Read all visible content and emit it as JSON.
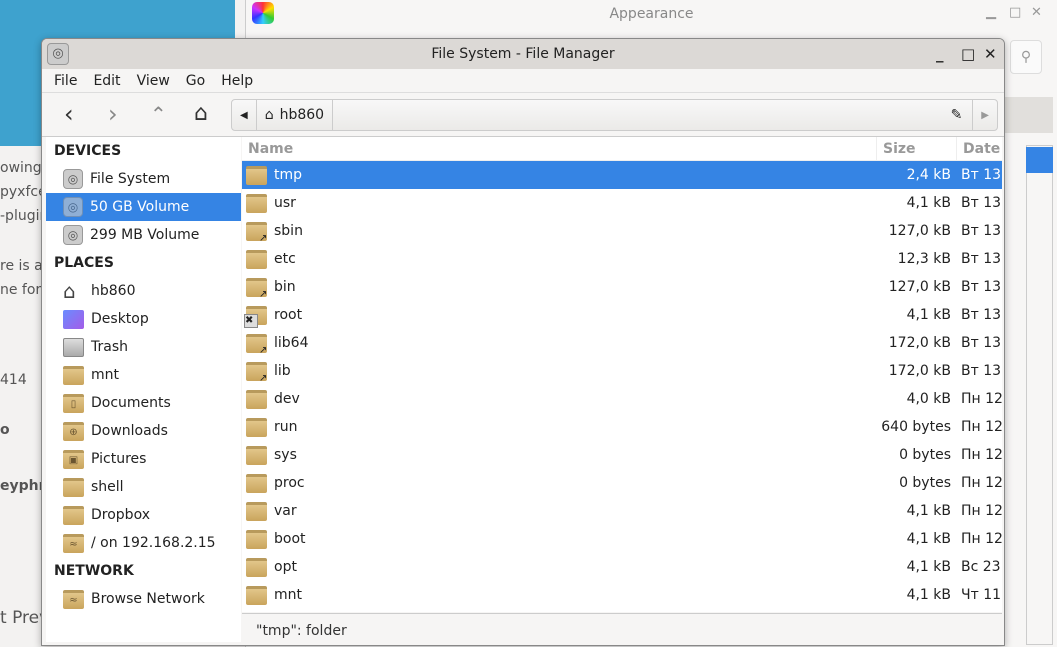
{
  "background": {
    "snippets": [
      "owing",
      "pyxfce",
      "-plugin",
      "re is a",
      "ne for",
      "414",
      "o",
      "eyphr",
      "t Prev"
    ],
    "other_window_title": "Appearance"
  },
  "window": {
    "title": "File System - File Manager"
  },
  "menu": [
    "File",
    "Edit",
    "View",
    "Go",
    "Help"
  ],
  "toolbar": {
    "path_segment": "hb860"
  },
  "sidebar": {
    "sections": [
      {
        "title": "DEVICES",
        "items": [
          {
            "label": "File System",
            "icon": "disk-icon"
          },
          {
            "label": "50 GB Volume",
            "icon": "disk-icon",
            "selected": true
          },
          {
            "label": "299 MB Volume",
            "icon": "disk-icon"
          }
        ]
      },
      {
        "title": "PLACES",
        "items": [
          {
            "label": "hb860",
            "icon": "home-icon"
          },
          {
            "label": "Desktop",
            "icon": "desktop-icon"
          },
          {
            "label": "Trash",
            "icon": "trash-icon"
          },
          {
            "label": "mnt",
            "icon": "folder-icon"
          },
          {
            "label": "Documents",
            "icon": "folder-documents-icon"
          },
          {
            "label": "Downloads",
            "icon": "folder-downloads-icon"
          },
          {
            "label": "Pictures",
            "icon": "folder-pictures-icon"
          },
          {
            "label": "shell",
            "icon": "folder-icon"
          },
          {
            "label": "Dropbox",
            "icon": "folder-icon"
          },
          {
            "label": "/ on 192.168.2.15",
            "icon": "folder-network-icon"
          }
        ]
      },
      {
        "title": "NETWORK",
        "items": [
          {
            "label": "Browse Network",
            "icon": "folder-network-icon"
          }
        ]
      }
    ]
  },
  "list": {
    "columns": [
      "Name",
      "Size",
      "Date"
    ],
    "rows": [
      {
        "name": "tmp",
        "size": "2,4 kB",
        "date": "Вт 13",
        "selected": true
      },
      {
        "name": "usr",
        "size": "4,1 kB",
        "date": "Вт 13"
      },
      {
        "name": "sbin",
        "size": "127,0 kB",
        "date": "Вт 13",
        "link": true
      },
      {
        "name": "etc",
        "size": "12,3 kB",
        "date": "Вт 13"
      },
      {
        "name": "bin",
        "size": "127,0 kB",
        "date": "Вт 13",
        "link": true
      },
      {
        "name": "root",
        "size": "4,1 kB",
        "date": "Вт 13",
        "locked": true
      },
      {
        "name": "lib64",
        "size": "172,0 kB",
        "date": "Вт 13",
        "link": true
      },
      {
        "name": "lib",
        "size": "172,0 kB",
        "date": "Вт 13",
        "link": true
      },
      {
        "name": "dev",
        "size": "4,0 kB",
        "date": "Пн 12"
      },
      {
        "name": "run",
        "size": "640 bytes",
        "date": "Пн 12"
      },
      {
        "name": "sys",
        "size": "0 bytes",
        "date": "Пн 12"
      },
      {
        "name": "proc",
        "size": "0 bytes",
        "date": "Пн 12"
      },
      {
        "name": "var",
        "size": "4,1 kB",
        "date": "Пн 12"
      },
      {
        "name": "boot",
        "size": "4,1 kB",
        "date": "Пн 12"
      },
      {
        "name": "opt",
        "size": "4,1 kB",
        "date": "Вс 23"
      },
      {
        "name": "mnt",
        "size": "4,1 kB",
        "date": "Чт 11"
      }
    ]
  },
  "status": "\"tmp\": folder",
  "colors": {
    "selection": "#3584e4",
    "folder": "#d4b06e"
  }
}
